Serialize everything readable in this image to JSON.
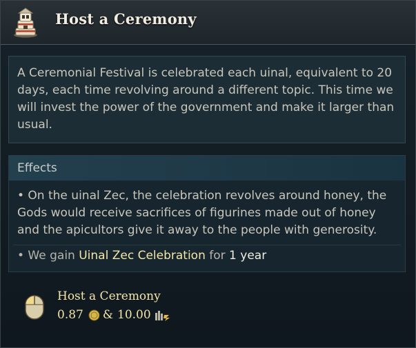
{
  "header": {
    "title": "Host a Ceremony",
    "icon": "lighthouse-tower-icon"
  },
  "description": {
    "text": "A Ceremonial Festival is celebrated each uinal, equivalent to 20 days, each time revolving around a different topic. This time we will invest the power of the government and make it larger than usual."
  },
  "effects": {
    "title": "Effects",
    "items": [
      "• On the uinal Zec, the celebration revolves around honey, the Gods would receive sacrifices of figurines made out of honey and the apicultors give it away to the people with generosity."
    ],
    "gain": {
      "prefix": "• We gain",
      "modifier": "Uinal Zec Celebration",
      "for": "for",
      "duration": "1 year"
    }
  },
  "action": {
    "label": "Host a Ceremony",
    "icon": "mouse-left-click-icon",
    "cost_gold": "0.87",
    "gold_icon": "gold-coin-icon",
    "separator": "&",
    "cost_influence": "10.00",
    "influence_icon": "influence-icon"
  },
  "colors": {
    "title": "#f1ece0",
    "highlight": "#f3e6a8",
    "text": "#c9c6bc",
    "background": "#121c22",
    "effects_header": "#23404e"
  }
}
